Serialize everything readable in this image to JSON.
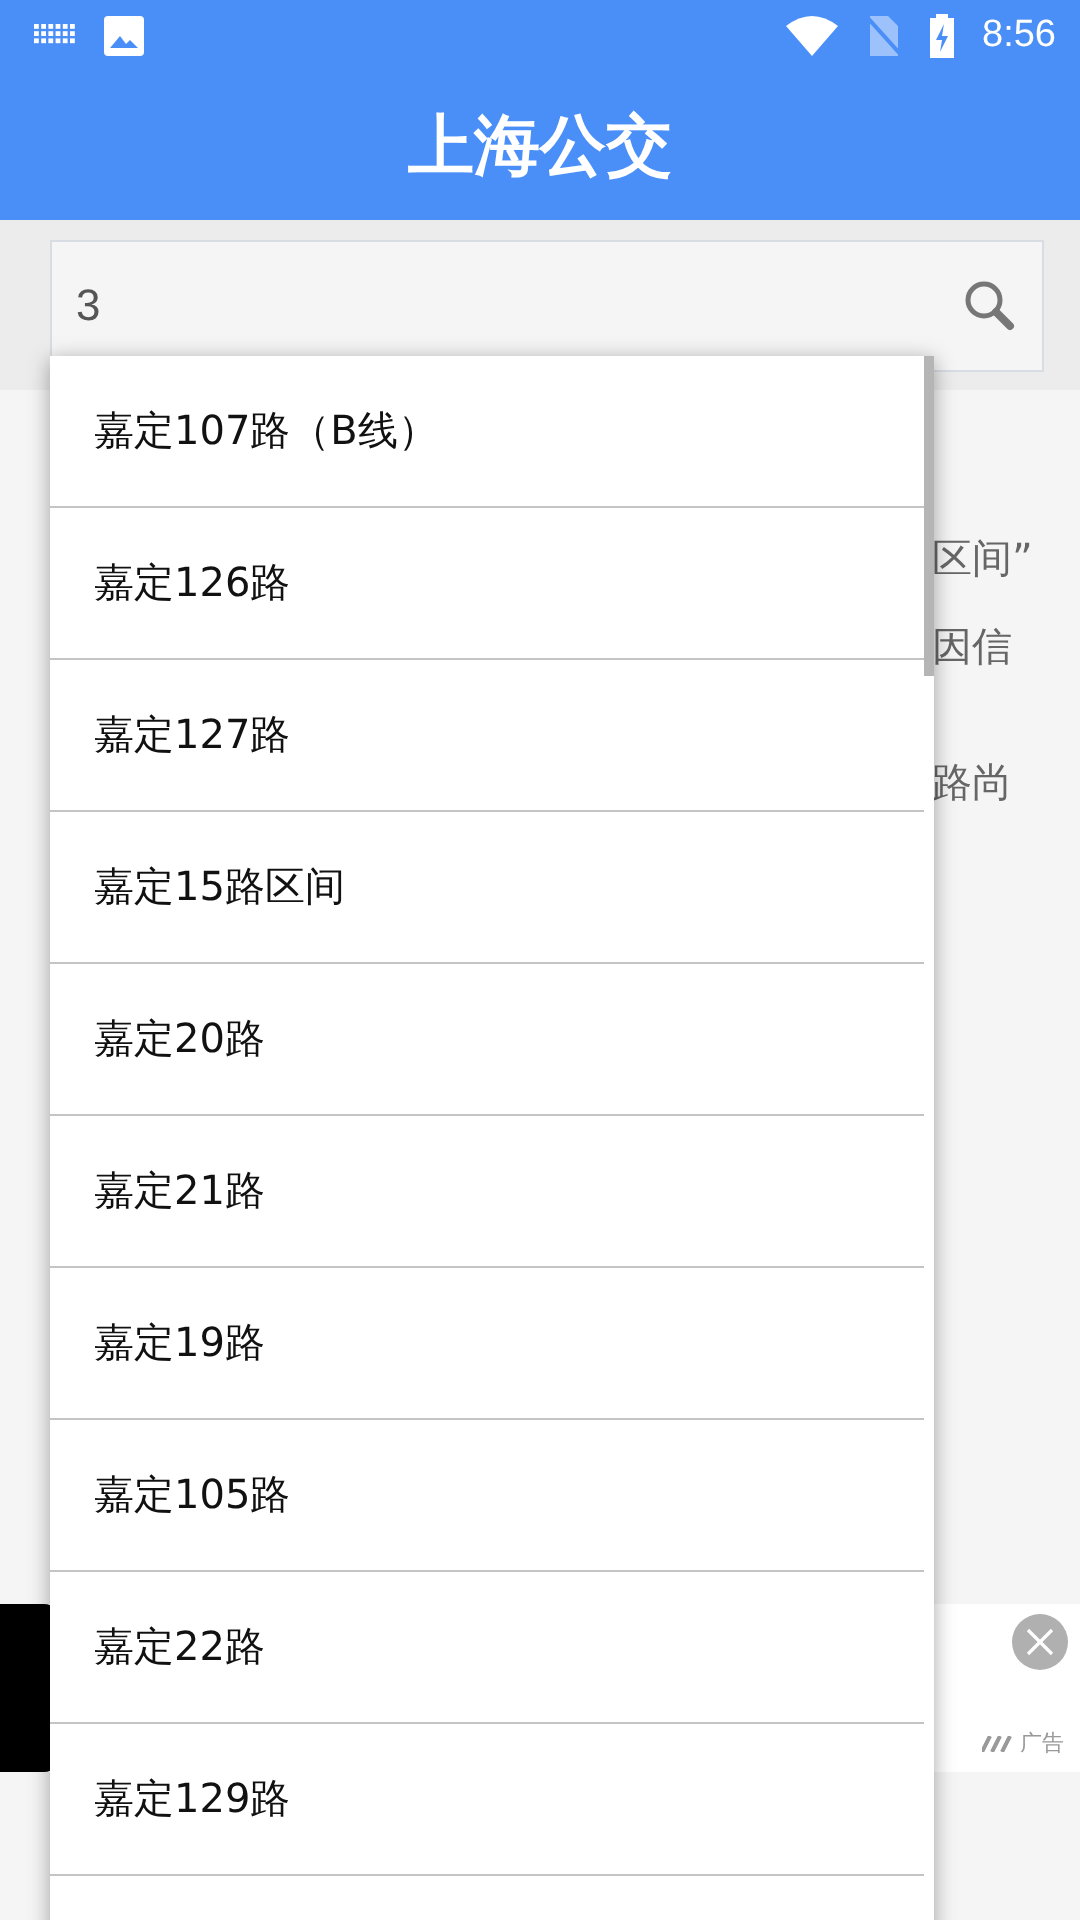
{
  "status_bar": {
    "time": "8:56"
  },
  "app_bar": {
    "title": "上海公交"
  },
  "search": {
    "value": "3"
  },
  "background_text": [
    "区间”",
    "因信",
    "路尚"
  ],
  "suggestions": [
    {
      "label": "嘉定107路（B线）"
    },
    {
      "label": "嘉定126路"
    },
    {
      "label": "嘉定127路"
    },
    {
      "label": "嘉定15路区间"
    },
    {
      "label": "嘉定20路"
    },
    {
      "label": "嘉定21路"
    },
    {
      "label": "嘉定19路"
    },
    {
      "label": "嘉定105路"
    },
    {
      "label": "嘉定22路"
    },
    {
      "label": "嘉定129路"
    }
  ],
  "ad": {
    "label": "广告"
  }
}
